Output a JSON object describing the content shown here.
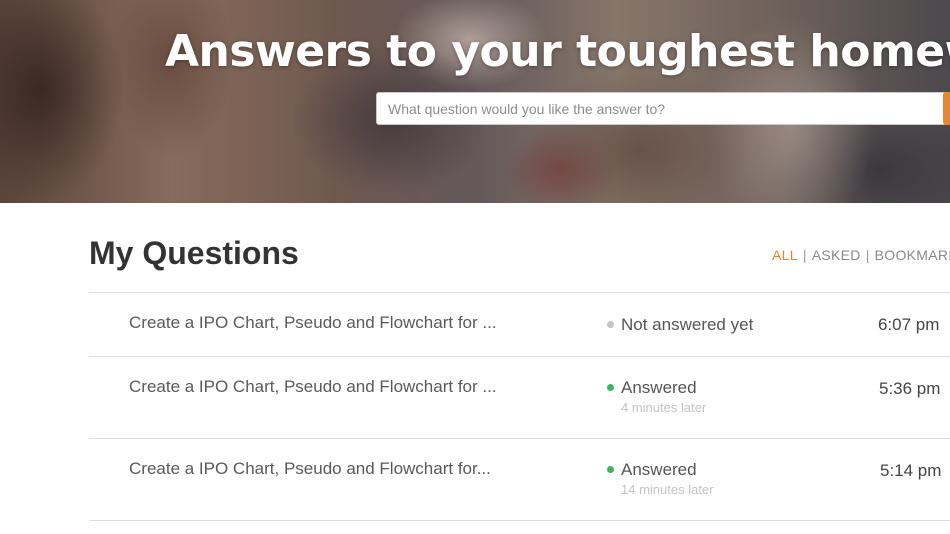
{
  "hero": {
    "title": "Answers to your toughest homework",
    "search_placeholder": "What question would you like the answer to?"
  },
  "main": {
    "title": "My Questions",
    "filters": [
      {
        "label": "ALL",
        "active": true
      },
      {
        "label": "ASKED",
        "active": false
      },
      {
        "label": "BOOKMARKE",
        "active": false
      }
    ],
    "questions": [
      {
        "title": "Create a IPO Chart, Pseudo and Flowchart for ...",
        "status": "Not answered yet",
        "status_color": "#c4c4c4",
        "answered_after": "",
        "time": "6:07 pm"
      },
      {
        "title": "Create a IPO Chart, Pseudo and Flowchart for ...",
        "status": "Answered",
        "status_color": "#3cb55a",
        "answered_after": "4 minutes later",
        "time": "5:36 pm"
      },
      {
        "title": "Create a IPO Chart, Pseudo and Flowchart for...",
        "status": "Answered",
        "status_color": "#3cb55a",
        "answered_after": "14 minutes later",
        "time": "5:14 pm"
      }
    ]
  },
  "colors": {
    "accent": "#e8862b",
    "answered": "#3cb55a",
    "unanswered": "#c4c4c4"
  }
}
